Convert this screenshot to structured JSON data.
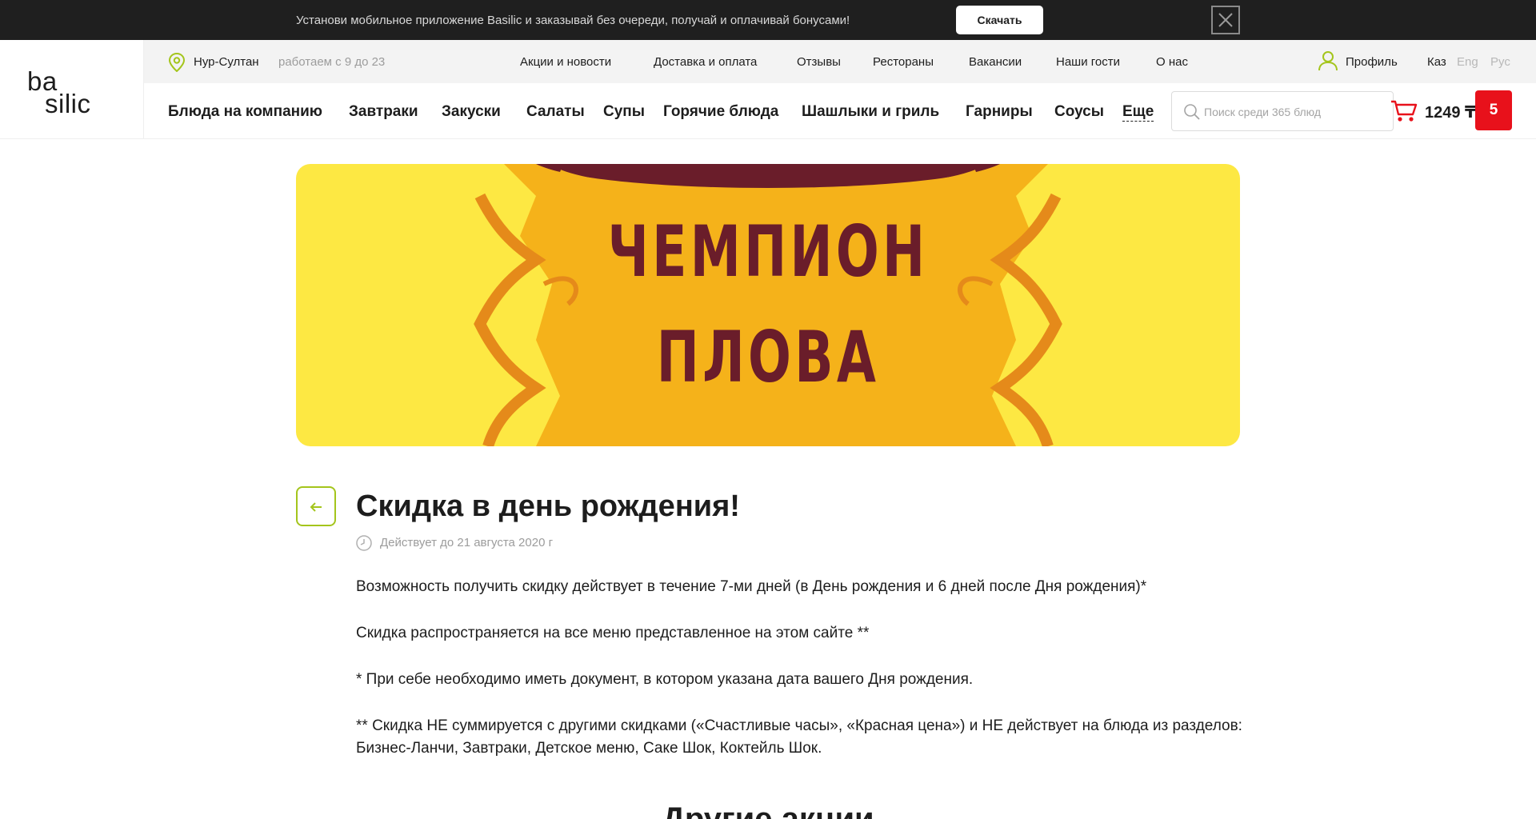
{
  "app_banner": {
    "message": "Установи мобильное приложение Basilic и заказывай без очереди, получай и оплачивай бонусами!",
    "download_label": "Скачать"
  },
  "logo": {
    "line1": "ba",
    "line2": "silic"
  },
  "infobar": {
    "city": "Нур-Султан",
    "hours": "работаем с 9 до 23",
    "links": [
      "Акции и новости",
      "Доставка и оплата",
      "Отзывы",
      "Рестораны",
      "Вакансии",
      "Наши гости",
      "О нас"
    ],
    "profile": "Профиль",
    "languages": [
      "Каз",
      "Eng",
      "Рус"
    ]
  },
  "mainnav": {
    "items": [
      "Блюда на компанию",
      "Завтраки",
      "Закуски",
      "Салаты",
      "Супы",
      "Горячие блюда",
      "Шашлыки и гриль",
      "Гарниры",
      "Соусы",
      "Еще"
    ]
  },
  "search": {
    "placeholder": "Поиск среди 365 блюд"
  },
  "cart": {
    "total": "1249 ₸",
    "count": "5"
  },
  "promo_banner": {
    "line1": "ЧЕМПИОН",
    "line2": "ПЛОВА"
  },
  "article": {
    "title": "Скидка в день рождения!",
    "valid_until": "Действует до 21 августа 2020 г",
    "paragraphs": [
      "Возможность получить скидку действует в течение 7-ми дней (в День рождения и 6 дней после Дня рождения)*",
      "Скидка распространяется на все меню представленное на этом сайте **",
      "* При себе необходимо иметь документ, в котором указана дата вашего Дня рождения.",
      "** Скидка НЕ суммируется с другими скидками («Счастливые часы», «Красная цена») и НЕ действует на блюда из разделов: Бизнес-Ланчи, Завтраки, Детское меню, Саке Шок, Коктейль Шок."
    ]
  },
  "other_promos_heading": "Другие акции",
  "colors": {
    "accent_green": "#a4c51c",
    "cart_red": "#e8111b",
    "banner_yellow": "#fde843",
    "banner_text": "#6a1d2a"
  }
}
